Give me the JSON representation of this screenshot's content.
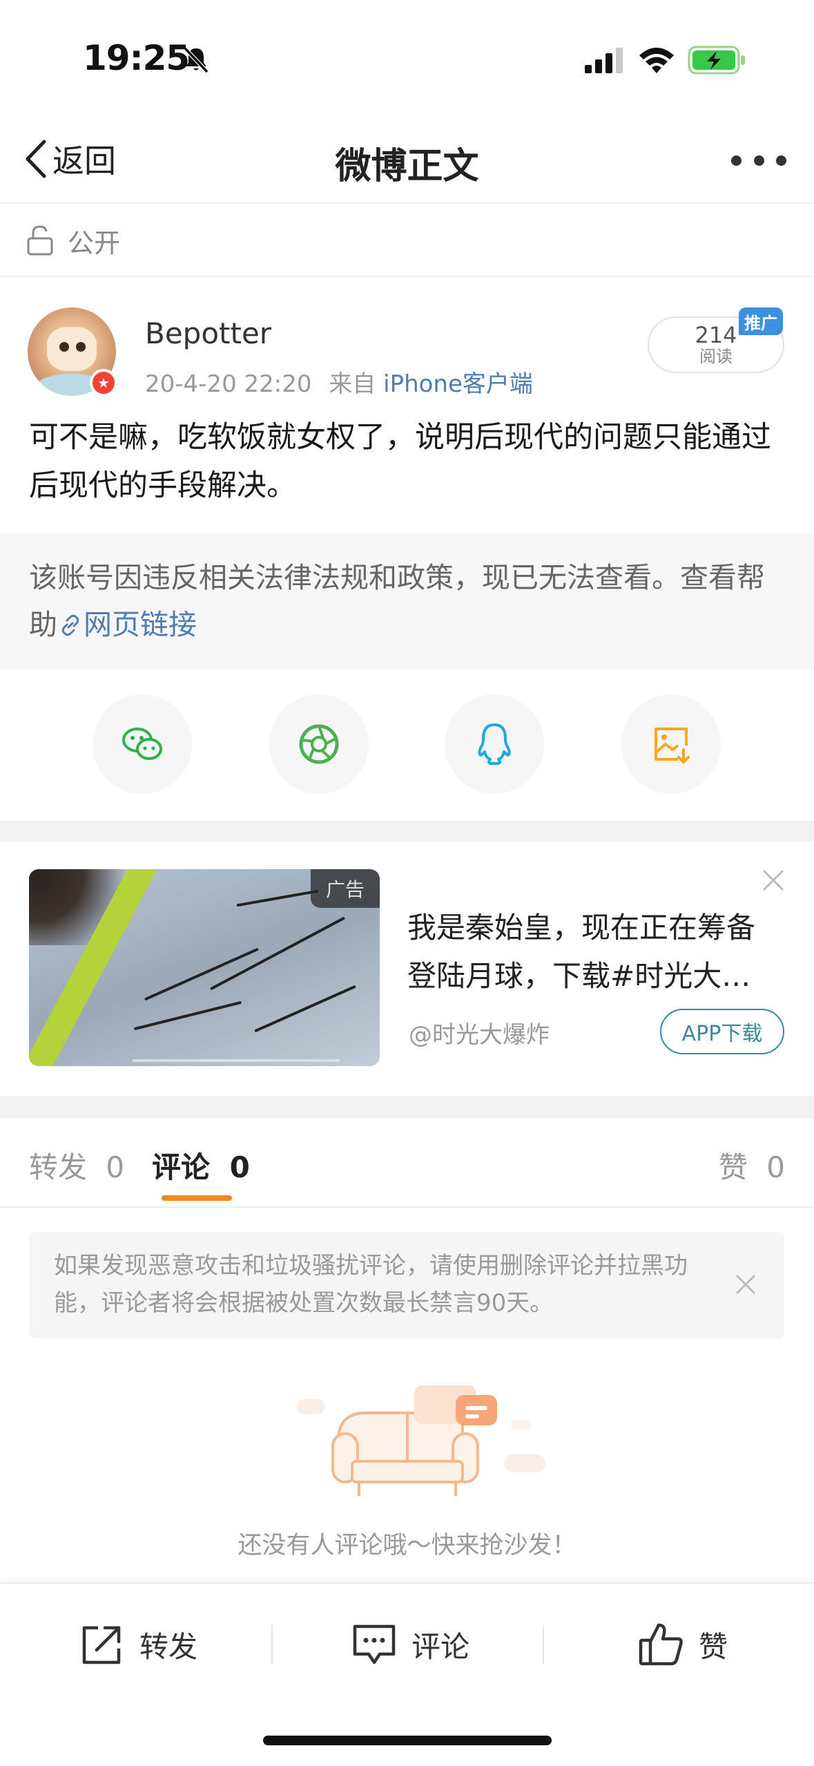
{
  "status_bar": {
    "time": "19:25"
  },
  "nav": {
    "back_label": "返回",
    "title": "微博正文"
  },
  "visibility": {
    "label": "公开"
  },
  "post": {
    "username": "Bepotter",
    "datetime": "20-4-20 22:20",
    "source_prefix": "来自",
    "source": "iPhone客户端",
    "read_count": "214",
    "read_label": "阅读",
    "promo_tag": "推广",
    "text": "可不是嘛，吃软饭就女权了，说明后现代的问题只能通过后现代的手段解决。"
  },
  "removed": {
    "text": "该账号因违反相关法律法规和政策，现已无法查看。查看帮助",
    "link_label": "网页链接"
  },
  "share": {
    "items": [
      {
        "icon": "wechat-icon",
        "color": "#2fb24a"
      },
      {
        "icon": "moments-icon",
        "color": "#4caf50"
      },
      {
        "icon": "qq-icon",
        "color": "#22a5e0"
      },
      {
        "icon": "save-image-icon",
        "color": "#f5a623"
      }
    ]
  },
  "ad": {
    "tag": "广告",
    "title_line1": "我是秦始皇，现在正在筹备",
    "title_line2": "登陆月球，下载#时光大…",
    "source": "@时光大爆炸",
    "download_label": "APP下载"
  },
  "tabs": {
    "repost_label": "转发",
    "repost_count": "0",
    "comment_label": "评论",
    "comment_count": "0",
    "like_label": "赞",
    "like_count": "0"
  },
  "notice": {
    "text": "如果发现恶意攻击和垃圾骚扰评论，请使用删除评论并拉黑功能，评论者将会根据被处置次数最长禁言90天。"
  },
  "empty_state": {
    "text": "还没有人评论哦～快来抢沙发！"
  },
  "bottom_bar": {
    "repost_label": "转发",
    "comment_label": "评论",
    "like_label": "赞"
  },
  "colors": {
    "link": "#507daf",
    "accent_orange": "#f08a1f",
    "promo_blue": "#3d8fe0",
    "download_teal": "#3b8a9c"
  }
}
